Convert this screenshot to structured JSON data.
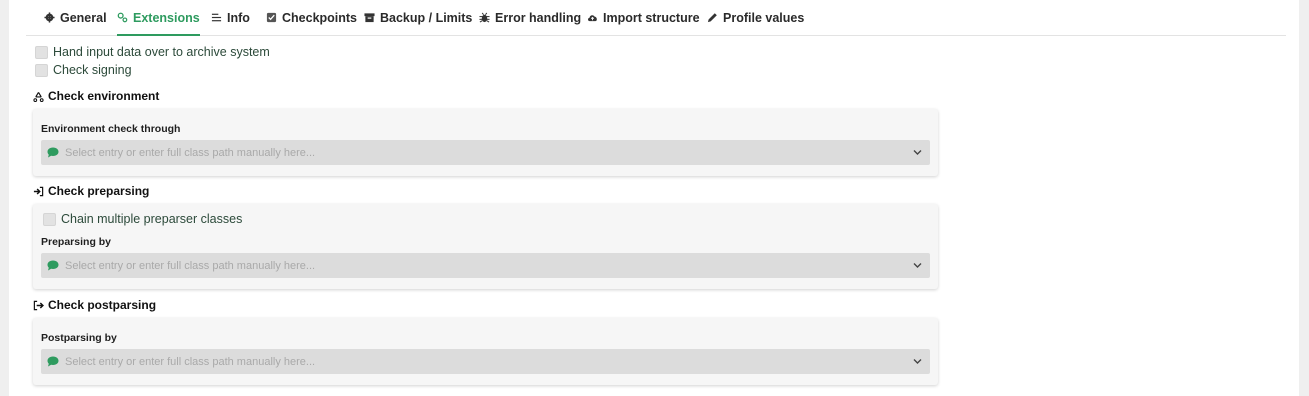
{
  "tabs": [
    {
      "label": "General",
      "icon": "gear-icon"
    },
    {
      "label": "Extensions",
      "icon": "cogs-icon",
      "active": true
    },
    {
      "label": "Info",
      "icon": "list-icon"
    },
    {
      "label": "Checkpoints",
      "icon": "checkbox-icon"
    },
    {
      "label": "Backup / Limits",
      "icon": "archive-icon"
    },
    {
      "label": "Error handling",
      "icon": "bug-icon"
    },
    {
      "label": "Import structure",
      "icon": "cloud-upload-icon"
    },
    {
      "label": "Profile values",
      "icon": "pen-icon"
    }
  ],
  "options": {
    "hand_input": {
      "label": "Hand input data over to archive system",
      "checked": false
    },
    "check_signing": {
      "label": "Check signing",
      "checked": false
    }
  },
  "environment": {
    "title": "Check environment",
    "field_label": "Environment check through",
    "placeholder": "Select entry or enter full class path manually here..."
  },
  "preparsing": {
    "title": "Check preparsing",
    "chain_label": "Chain multiple preparser classes",
    "field_label": "Preparsing by",
    "placeholder": "Select entry or enter full class path manually here..."
  },
  "postparsing": {
    "title": "Check postparsing",
    "field_label": "Postparsing by",
    "placeholder": "Select entry or enter full class path manually here..."
  },
  "colors": {
    "accent": "#2e9b5f",
    "select_bg": "#dcdcdc",
    "card_bg": "#f6f6f6"
  }
}
